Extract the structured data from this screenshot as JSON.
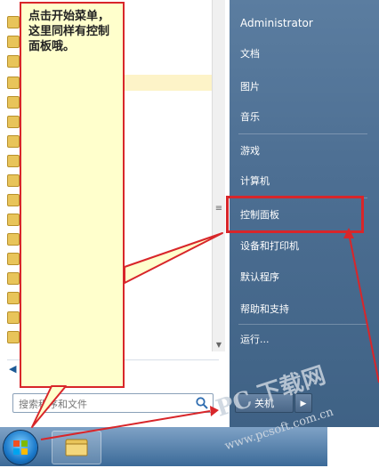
{
  "start_menu": {
    "user_name": "Administrator",
    "items": [
      {
        "label": "文档"
      },
      {
        "label": "图片"
      },
      {
        "label": "音乐"
      },
      {
        "label": "游戏"
      },
      {
        "label": "计算机"
      },
      {
        "label": "控制面板"
      },
      {
        "label": "设备和打印机"
      },
      {
        "label": "默认程序"
      },
      {
        "label": "帮助和支持"
      },
      {
        "label": "运行..."
      }
    ],
    "shutdown_label": "关机",
    "shutdown_arrow": "▶"
  },
  "search": {
    "placeholder": "搜索程序和文件"
  },
  "annotation": {
    "text": "点击开始菜单，这里同样有控制面板哦。"
  },
  "watermark": {
    "main": "PC 下载网",
    "sub": "www.pcsoft.com.cn"
  },
  "colors": {
    "highlight_red": "#d8262a",
    "callout_fill": "#ffffcc",
    "menu_blue": "#4d6f93"
  }
}
